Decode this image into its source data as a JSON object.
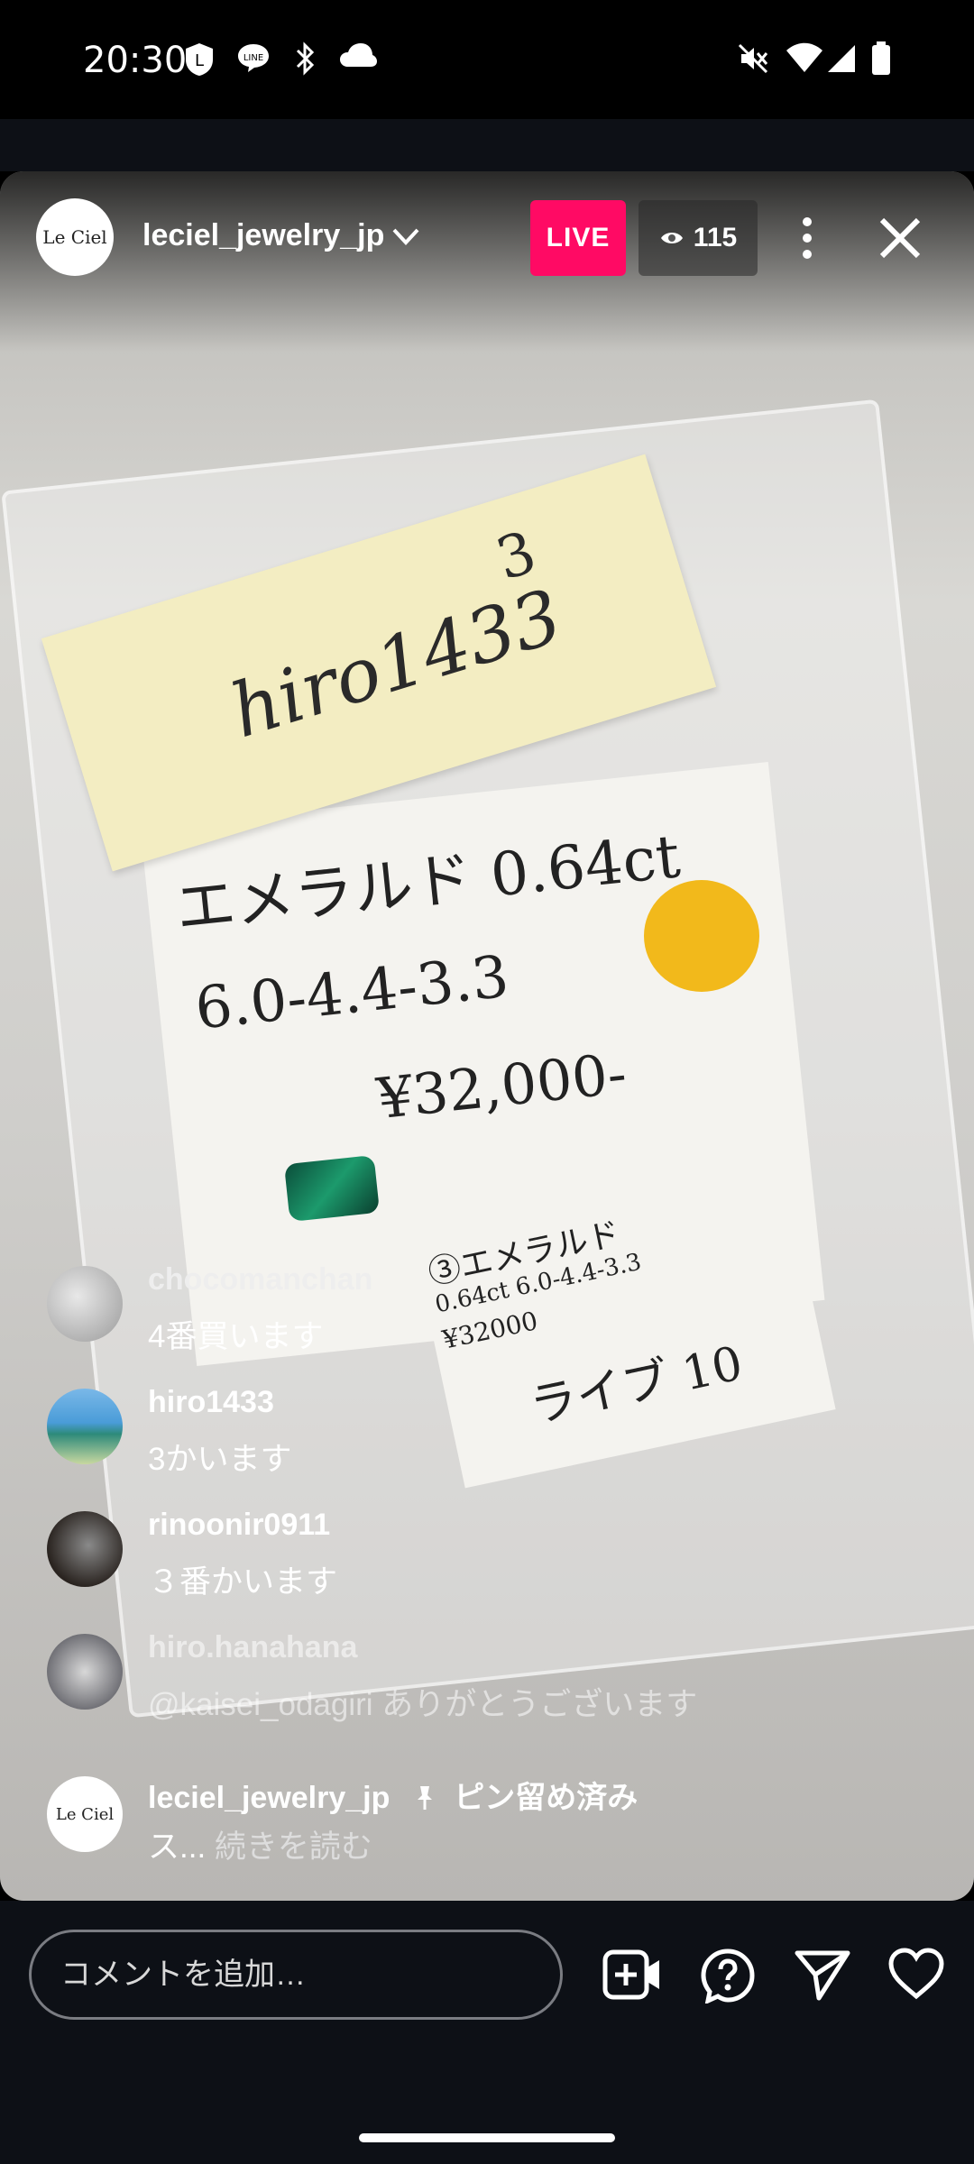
{
  "status_bar": {
    "time": "20:30",
    "left_icons": [
      "line-shield-icon",
      "line-app-icon",
      "bluetooth-icon",
      "cloud-icon"
    ],
    "right_icons": [
      "mute-icon",
      "wifi-icon",
      "signal-icon",
      "battery-icon"
    ]
  },
  "live": {
    "account": "leciel_jewelry_jp",
    "avatar_text": "Le Ciel",
    "live_badge": "LIVE",
    "viewer_count": "115",
    "accent": "#ff0a64"
  },
  "scene": {
    "note_name": "hiro1433",
    "note_number": "3",
    "card_line1": "エメラルド 0.64ct",
    "card_line2": "6.0-4.4-3.3",
    "card_line3": "¥32,000-",
    "label_line1": "③エメラルド",
    "label_line2": "0.64ct 6.0-4.4-3.3",
    "label_line3": "¥32000",
    "card_live": "ライブ 10"
  },
  "comments": [
    {
      "user": "chocomanchan",
      "text": "4番買います"
    },
    {
      "user": "hiro1433",
      "text": "3かいます"
    },
    {
      "user": "rinoonir0911",
      "text": "３番かいます"
    },
    {
      "user": "hiro.hanahana",
      "text": "@kaisei_odagiri ありがとうございます"
    }
  ],
  "pinned": {
    "user": "leciel_jewelry_jp",
    "pin_label": "ピン留め済み",
    "text": "ス...",
    "read_more": "続きを読む"
  },
  "bottom": {
    "placeholder": "コメントを追加…",
    "icons": [
      "add-video-icon",
      "question-icon",
      "send-icon",
      "heart-icon"
    ]
  }
}
